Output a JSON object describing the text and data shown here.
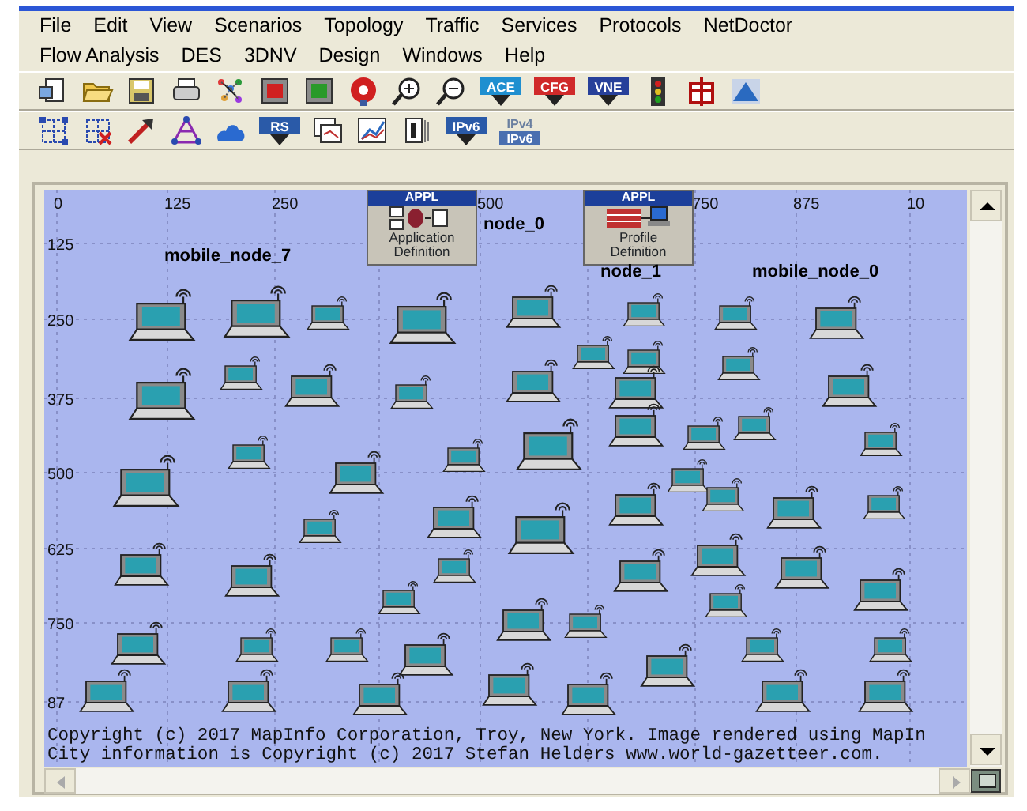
{
  "menu_bar": [
    [
      "File",
      "Edit",
      "View",
      "Scenarios",
      "Topology",
      "Traffic",
      "Services",
      "Protocols",
      "NetDoctor"
    ],
    [
      "Flow Analysis",
      "DES",
      "3DNV",
      "Design",
      "Windows",
      "Help"
    ]
  ],
  "toolbar": [
    [
      {
        "kind": "new"
      },
      {
        "kind": "open"
      },
      {
        "kind": "save"
      },
      {
        "kind": "print"
      },
      {
        "kind": "scatter"
      },
      {
        "kind": "red-square"
      },
      {
        "kind": "green-square"
      },
      {
        "kind": "red-circle"
      },
      {
        "kind": "zoom-in"
      },
      {
        "kind": "zoom-out"
      },
      {
        "kind": "badge",
        "text": "ACE",
        "color": "#1f8fd0"
      },
      {
        "kind": "badge",
        "text": "CFG",
        "color": "#d02a2a"
      },
      {
        "kind": "badge",
        "text": "VNE",
        "color": "#27409a"
      },
      {
        "kind": "traffic-light"
      },
      {
        "kind": "red-frame"
      },
      {
        "kind": "triangle"
      }
    ],
    [
      {
        "kind": "grid"
      },
      {
        "kind": "grid-x"
      },
      {
        "kind": "arrow"
      },
      {
        "kind": "network"
      },
      {
        "kind": "cloud"
      },
      {
        "kind": "badge",
        "text": "RS",
        "color": "#2a5aa8"
      },
      {
        "kind": "windows"
      },
      {
        "kind": "chart"
      },
      {
        "kind": "book"
      },
      {
        "kind": "badge",
        "text": "IPv6",
        "color": "#2a5aa8"
      },
      {
        "kind": "badge2",
        "text": "IPv4",
        "text2": "IPv6",
        "color": "#4a6fb0"
      }
    ]
  ],
  "canvas": {
    "x_ruler": [
      "0",
      "125",
      "250",
      "500",
      "750",
      "875",
      "10"
    ],
    "y_ruler": [
      "125",
      "250",
      "375",
      "500",
      "625",
      "750",
      "87"
    ],
    "objects": [
      {
        "header": "APPL",
        "label": "Application",
        "label2": "Definition",
        "kind": "application"
      },
      {
        "header": "APPL",
        "label": "Profile",
        "label2": "Definition",
        "kind": "profile"
      }
    ],
    "node_labels": [
      "node_0",
      "mobile_node_7",
      "node_1",
      "mobile_node_0"
    ],
    "copyright": [
      "Copyright (c) 2017 MapInfo Corporation, Troy, New York. Image rendered using MapIn",
      "City information is Copyright (c) 2017 Stefan Helders www.world-gazetteer.com."
    ]
  }
}
